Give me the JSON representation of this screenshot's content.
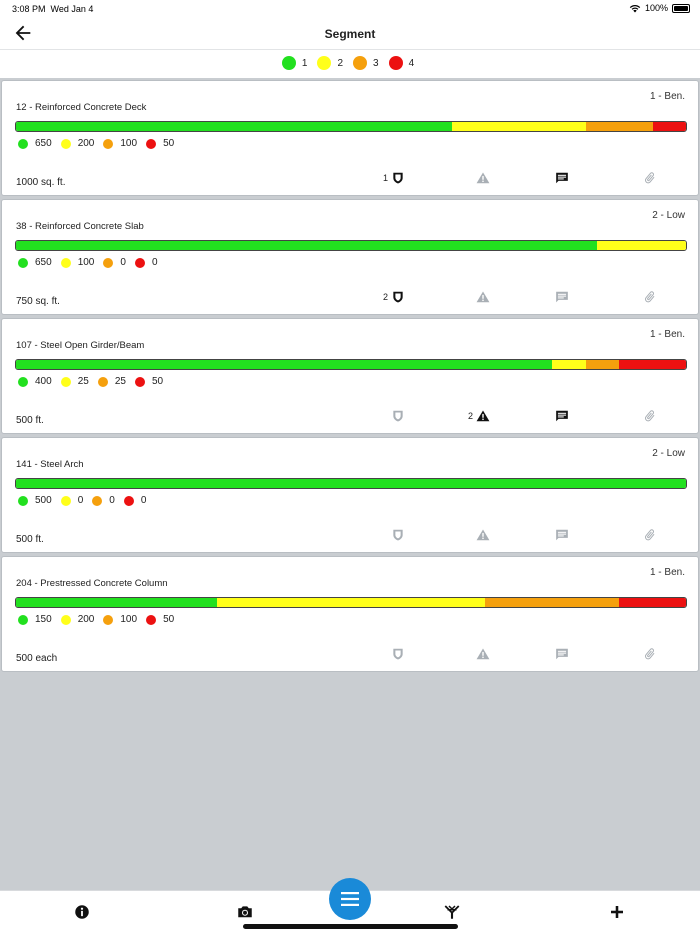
{
  "status_bar": {
    "time": "3:08 PM",
    "date": "Wed Jan 4",
    "battery": "100%"
  },
  "header": {
    "title": "Segment",
    "back_icon": "arrow-left-icon"
  },
  "legend": [
    {
      "label": "1",
      "color": "#22e01f"
    },
    {
      "label": "2",
      "color": "#ffff1a"
    },
    {
      "label": "3",
      "color": "#f5a00d"
    },
    {
      "label": "4",
      "color": "#ec1111"
    }
  ],
  "condition_colors": [
    "#22e01f",
    "#ffff1a",
    "#f5a00d",
    "#ec1111"
  ],
  "inactive_icon_color": "#a9afb5",
  "active_icon_color": "#111111",
  "elements": [
    {
      "name": "12 - Reinforced Concrete Deck",
      "rating": "1 - Ben.",
      "quantity": "1000 sq. ft.",
      "counts": [
        "650",
        "200",
        "100",
        "50"
      ],
      "fractions": [
        0.65,
        0.2,
        0.1,
        0.05
      ],
      "protection": {
        "count": "1",
        "active": true
      },
      "defects": {
        "count": "",
        "active": false
      },
      "notes": {
        "active": true
      },
      "attachments": {
        "active": false
      }
    },
    {
      "name": "38 - Reinforced Concrete Slab",
      "rating": "2 - Low",
      "quantity": "750 sq. ft.",
      "counts": [
        "650",
        "100",
        "0",
        "0"
      ],
      "fractions": [
        0.8667,
        0.1333,
        0,
        0
      ],
      "protection": {
        "count": "2",
        "active": true
      },
      "defects": {
        "count": "",
        "active": false
      },
      "notes": {
        "active": false
      },
      "attachments": {
        "active": false
      }
    },
    {
      "name": "107 - Steel Open Girder/Beam",
      "rating": "1 - Ben.",
      "quantity": "500 ft.",
      "counts": [
        "400",
        "25",
        "25",
        "50"
      ],
      "fractions": [
        0.8,
        0.05,
        0.05,
        0.1
      ],
      "protection": {
        "count": "",
        "active": false
      },
      "defects": {
        "count": "2",
        "active": true
      },
      "notes": {
        "active": true
      },
      "attachments": {
        "active": false
      }
    },
    {
      "name": "141 - Steel Arch",
      "rating": "2 - Low",
      "quantity": "500 ft.",
      "counts": [
        "500",
        "0",
        "0",
        "0"
      ],
      "fractions": [
        1,
        0,
        0,
        0
      ],
      "protection": {
        "count": "",
        "active": false
      },
      "defects": {
        "count": "",
        "active": false
      },
      "notes": {
        "active": false
      },
      "attachments": {
        "active": false
      }
    },
    {
      "name": "204 - Prestressed Concrete Column",
      "rating": "1 - Ben.",
      "quantity": "500 each",
      "counts": [
        "150",
        "200",
        "100",
        "50"
      ],
      "fractions": [
        0.3,
        0.4,
        0.2,
        0.1
      ],
      "protection": {
        "count": "",
        "active": false
      },
      "defects": {
        "count": "",
        "active": false
      },
      "notes": {
        "active": false
      },
      "attachments": {
        "active": false
      }
    }
  ],
  "bottom_bar": {
    "tabs": [
      "info-icon",
      "camera-icon",
      "menu-icon",
      "structure-icon",
      "plus-icon"
    ]
  }
}
